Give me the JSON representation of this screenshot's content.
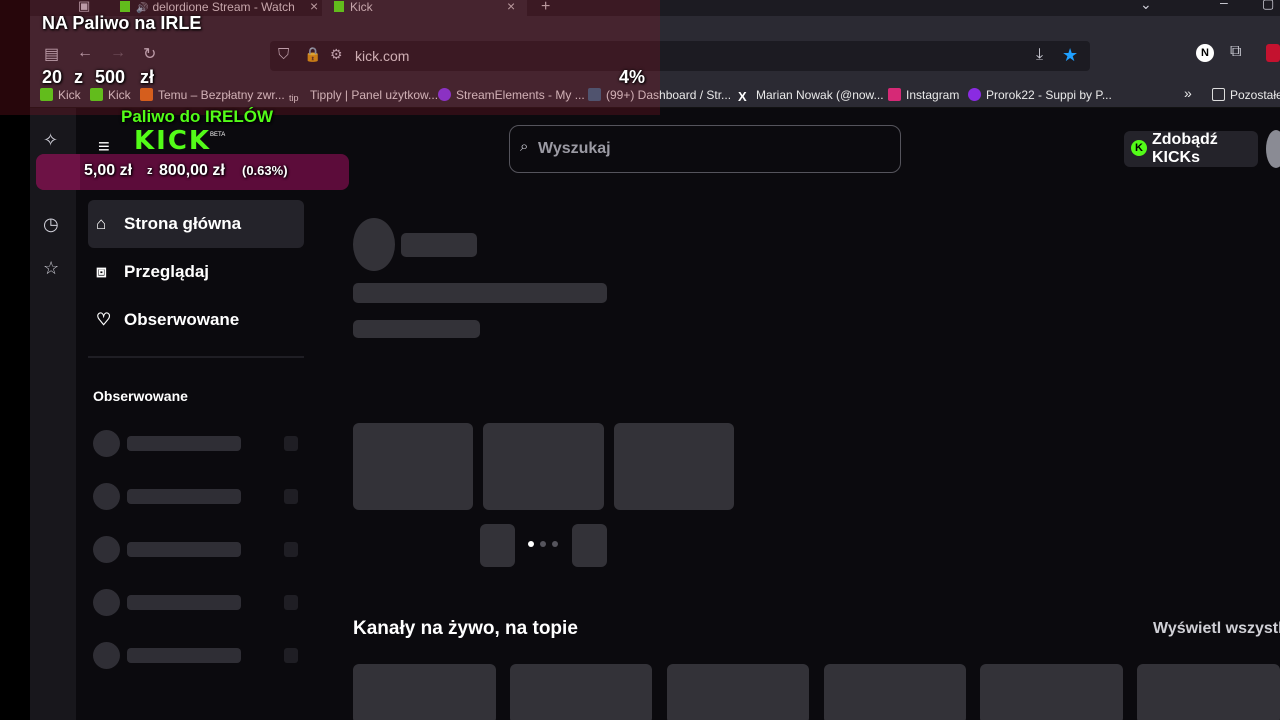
{
  "colors": {
    "brand": "#53fc18",
    "overlay": "#5c0c3a",
    "page_bg": "#0b0a0e"
  },
  "tabs": [
    {
      "label": "delordione Stream - Watch",
      "active": false
    },
    {
      "label": "Kick",
      "active": true
    }
  ],
  "tab_close": "×",
  "new_tab": "+",
  "address": {
    "url": "kick.com"
  },
  "bookmarks": [
    {
      "label": "Kick",
      "icon": "kick-icon"
    },
    {
      "label": "Kick",
      "icon": "kick-icon"
    },
    {
      "label": "Temu – Bezpłatny zwr...",
      "icon": "temu-icon"
    },
    {
      "label": "Tipply | Panel użytkow...",
      "icon": "tipply-icon"
    },
    {
      "label": "StreamElements - My ...",
      "icon": "streamelements-icon"
    },
    {
      "label": "(99+) Dashboard / Str...",
      "icon": "dashboard-icon"
    },
    {
      "label": "Marian Nowak (@now...",
      "icon": "x-icon"
    },
    {
      "label": "Instagram",
      "icon": "instagram-icon"
    },
    {
      "label": "Prorok22 - Suppi by P...",
      "icon": "suppi-icon"
    }
  ],
  "bookmarks_overflow": "»",
  "bookmarks_other": "Pozostałe",
  "overlay": {
    "goal_title": "NA Paliwo na IRLE",
    "goal_current": "20",
    "goal_sep": "z",
    "goal_target": "500",
    "goal_currency": "zł",
    "goal_percent": "4%",
    "goal2_title": "Paliwo do IRELÓW",
    "goal2_amount": "5,00 zł",
    "goal2_sep": "z",
    "goal2_target": "800,00 zł",
    "goal2_percent": "(0.63%)",
    "goal2_progress": 0.0063
  },
  "site": {
    "logo": "KICK",
    "logo_badge": "BETA",
    "search_placeholder": "Wyszukaj",
    "get_kicks": "Zdobądź KICKs",
    "nav": [
      {
        "label": "Strona główna",
        "icon": "home-icon",
        "active": true
      },
      {
        "label": "Przeglądaj",
        "icon": "browse-icon",
        "active": false
      },
      {
        "label": "Obserwowane",
        "icon": "heart-icon",
        "active": false
      }
    ],
    "following_header": "Obserwowane",
    "section_title": "Kanały na żywo, na topie",
    "view_all": "Wyświetl wszystkie"
  }
}
